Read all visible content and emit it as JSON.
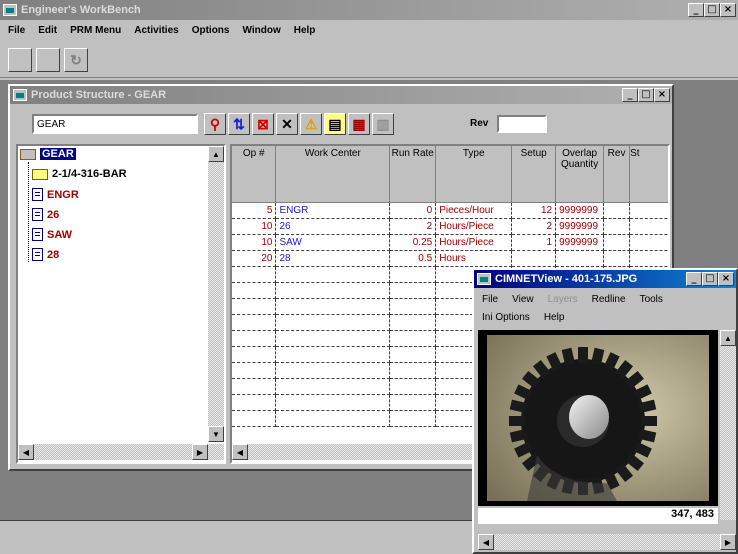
{
  "app": {
    "title": "Engineer's WorkBench",
    "menu": [
      "File",
      "Edit",
      "PRM Menu",
      "Activities",
      "Options",
      "Window",
      "Help"
    ]
  },
  "product_window": {
    "title": "Product Structure - GEAR",
    "search_value": "GEAR",
    "rev_label": "Rev",
    "rev_value": "",
    "tree": {
      "root": "GEAR",
      "children": [
        {
          "label": "2-1/4-316-BAR",
          "kind": "folder"
        },
        {
          "label": "ENGR",
          "kind": "doc"
        },
        {
          "label": "26",
          "kind": "doc"
        },
        {
          "label": "SAW",
          "kind": "doc"
        },
        {
          "label": "28",
          "kind": "doc"
        }
      ]
    },
    "columns": [
      "Op #",
      "Work Center",
      "Run Rate",
      "Type",
      "Setup",
      "Overlap Quantity",
      "Rev",
      "St"
    ],
    "rows": [
      {
        "op": "5",
        "wc": "ENGR",
        "rate": "0",
        "type": "Pieces/Hour",
        "setup": "12",
        "overlap": "9999999"
      },
      {
        "op": "10",
        "wc": "26",
        "rate": "2",
        "type": "Hours/Piece",
        "setup": "2",
        "overlap": "9999999"
      },
      {
        "op": "10",
        "wc": "SAW",
        "rate": "0.25",
        "type": "Hours/Piece",
        "setup": "1",
        "overlap": "9999999"
      },
      {
        "op": "20",
        "wc": "28",
        "rate": "0.5",
        "type": "Hours",
        "setup": "",
        "overlap": ""
      }
    ]
  },
  "viewer_window": {
    "title": "CIMNETView - 401-175.JPG",
    "menu1": [
      "File",
      "View",
      "Layers",
      "Redline",
      "Tools"
    ],
    "menu2": [
      "Ini Options",
      "Help"
    ],
    "coords": "347, 483"
  },
  "colors": {
    "titlebar": "#000080",
    "link": "#1a1ad0",
    "tree_text": "#a00000"
  }
}
